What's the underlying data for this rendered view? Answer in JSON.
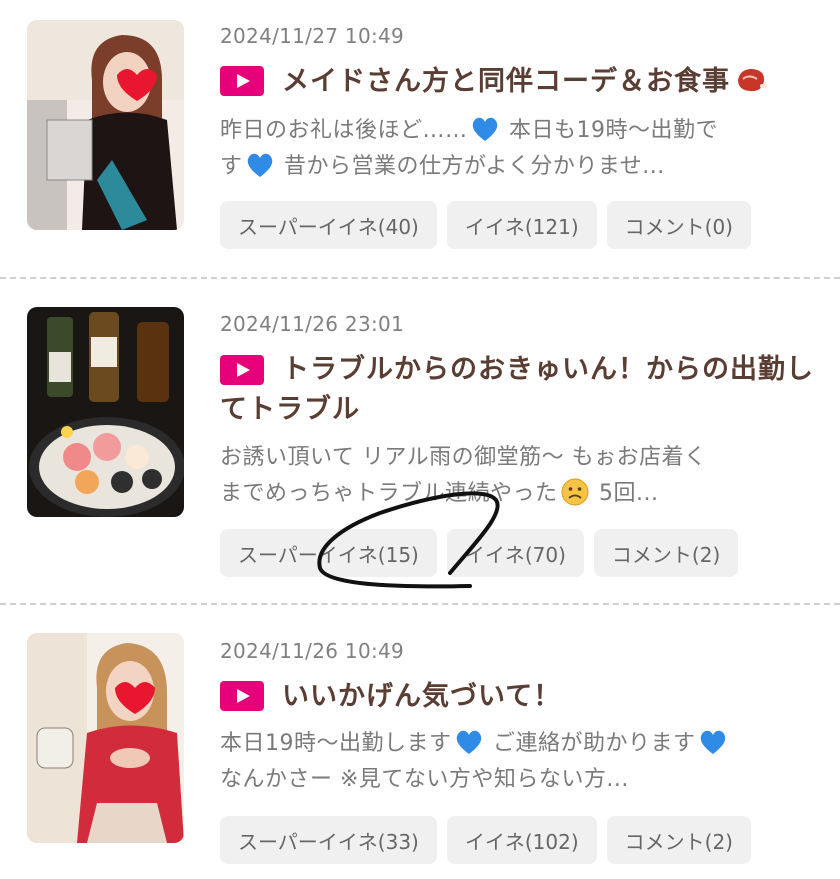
{
  "posts": [
    {
      "date": "2024/11/27 10:49",
      "title": "メイドさん方と同伴コーデ＆お食事",
      "title_icon": "meat-icon",
      "excerpt_1": "昨日のお礼は後ほど……",
      "excerpt_2": " 本日も19時〜出勤でです",
      "excerpt_2a": " 本日も19時〜出勤で",
      "excerpt_3": "す",
      "excerpt_4": " 昔から営業の仕方がよく分かりませ...",
      "btn_super": "スーパーイイネ(40)",
      "btn_like": "イイネ(121)",
      "btn_comment": "コメント(0)"
    },
    {
      "date": "2024/11/26 23:01",
      "title": "トラブルからのおきゅいん！からの出勤してトラブル",
      "excerpt_1": "お誘い頂いて リアル雨の御堂筋〜 もぉお店着く",
      "excerpt_2": "までめっちゃトラブル連続やった",
      "excerpt_3": " 5回...",
      "btn_super": "スーパーイイネ(15)",
      "btn_like": "イイネ(70)",
      "btn_comment": "コメント(2)"
    },
    {
      "date": "2024/11/26 10:49",
      "title": "いいかげん気づいて！",
      "excerpt_1": "本日19時〜出勤します",
      "excerpt_2": " ご連絡が助かります",
      "excerpt_3": "なんかさー ※見てない方や知らない方...",
      "btn_super": "スーパーイイネ(33)",
      "btn_like": "イイネ(102)",
      "btn_comment": "コメント(2)"
    }
  ],
  "colors": {
    "play_icon": "#e6007a",
    "title": "#5a3d33",
    "heart": "#2f8be6"
  },
  "annotation": "hand-drawn-scribble"
}
